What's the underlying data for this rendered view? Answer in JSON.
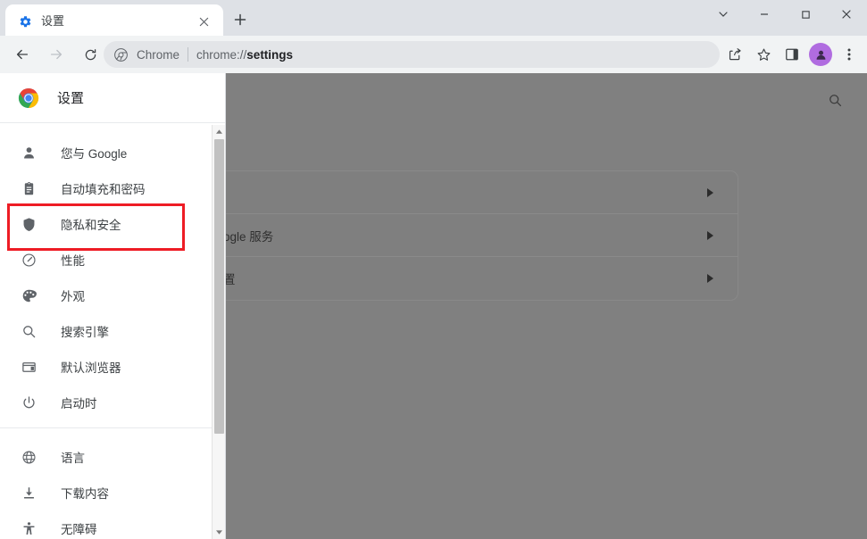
{
  "window": {
    "controls": [
      {
        "name": "tab-search",
        "icon": "chevron-down-icon",
        "label": "∨"
      },
      {
        "name": "minimize",
        "icon": "minimize-icon",
        "label": "—"
      },
      {
        "name": "maximize",
        "icon": "maximize-icon",
        "label": "□"
      },
      {
        "name": "close",
        "icon": "close-icon",
        "label": "✕"
      }
    ]
  },
  "tab": {
    "title": "设置",
    "favicon": "gear-icon",
    "close_label": "✕",
    "new_tab_label": "+"
  },
  "toolbar": {
    "back_label": "←",
    "forward_label": "→",
    "reload_label": "⟳",
    "omnibox": {
      "scheme_icon": "chrome-icon",
      "chrome_label": "Chrome",
      "separator": "|",
      "url_prefix": "chrome://",
      "url_bold": "settings",
      "full_url": "chrome://settings"
    },
    "actions": [
      {
        "name": "share-icon",
        "label": "↱"
      },
      {
        "name": "bookmark-star-icon",
        "label": "☆"
      },
      {
        "name": "side-panel-icon",
        "label": "◧"
      },
      {
        "name": "profile-avatar",
        "label": ""
      },
      {
        "name": "more-menu-icon",
        "label": "⋮"
      }
    ],
    "avatar_color": "#b06ce0"
  },
  "settings": {
    "header": {
      "logo": "chrome-logo-icon",
      "title": "设置"
    },
    "nav_primary": [
      {
        "id": "you-and-google",
        "icon": "person-icon",
        "label": "您与 Google",
        "highlighted": false
      },
      {
        "id": "autofill-passwords",
        "icon": "clipboard-icon",
        "label": "自动填充和密码",
        "highlighted": false
      },
      {
        "id": "privacy-security",
        "icon": "shield-icon",
        "label": "隐私和安全",
        "highlighted": true
      },
      {
        "id": "performance",
        "icon": "gauge-icon",
        "label": "性能",
        "highlighted": false
      },
      {
        "id": "appearance",
        "icon": "palette-icon",
        "label": "外观",
        "highlighted": false
      },
      {
        "id": "search-engine",
        "icon": "search-icon",
        "label": "搜索引擎",
        "highlighted": false
      },
      {
        "id": "default-browser",
        "icon": "browser-window-icon",
        "label": "默认浏览器",
        "highlighted": false
      },
      {
        "id": "on-startup",
        "icon": "power-icon",
        "label": "启动时",
        "highlighted": false
      }
    ],
    "nav_secondary": [
      {
        "id": "languages",
        "icon": "globe-icon",
        "label": "语言"
      },
      {
        "id": "downloads",
        "icon": "download-icon",
        "label": "下载内容"
      },
      {
        "id": "accessibility",
        "icon": "accessibility-icon",
        "label": "无障碍"
      }
    ],
    "scrollbar": {
      "up_label": "▲",
      "down_label": "▼"
    },
    "annotation": {
      "target": "隐私和安全",
      "color": "#ee1c25"
    }
  },
  "content": {
    "search_icon": "search-icon",
    "dim_color": "#808080",
    "cards": [
      {
        "id": "card-row-1",
        "label": "",
        "arrow": "▸"
      },
      {
        "id": "card-row-2",
        "label": "ogle 服务",
        "arrow": "▸"
      },
      {
        "id": "card-row-3",
        "label": "置",
        "arrow": "▸"
      }
    ]
  }
}
